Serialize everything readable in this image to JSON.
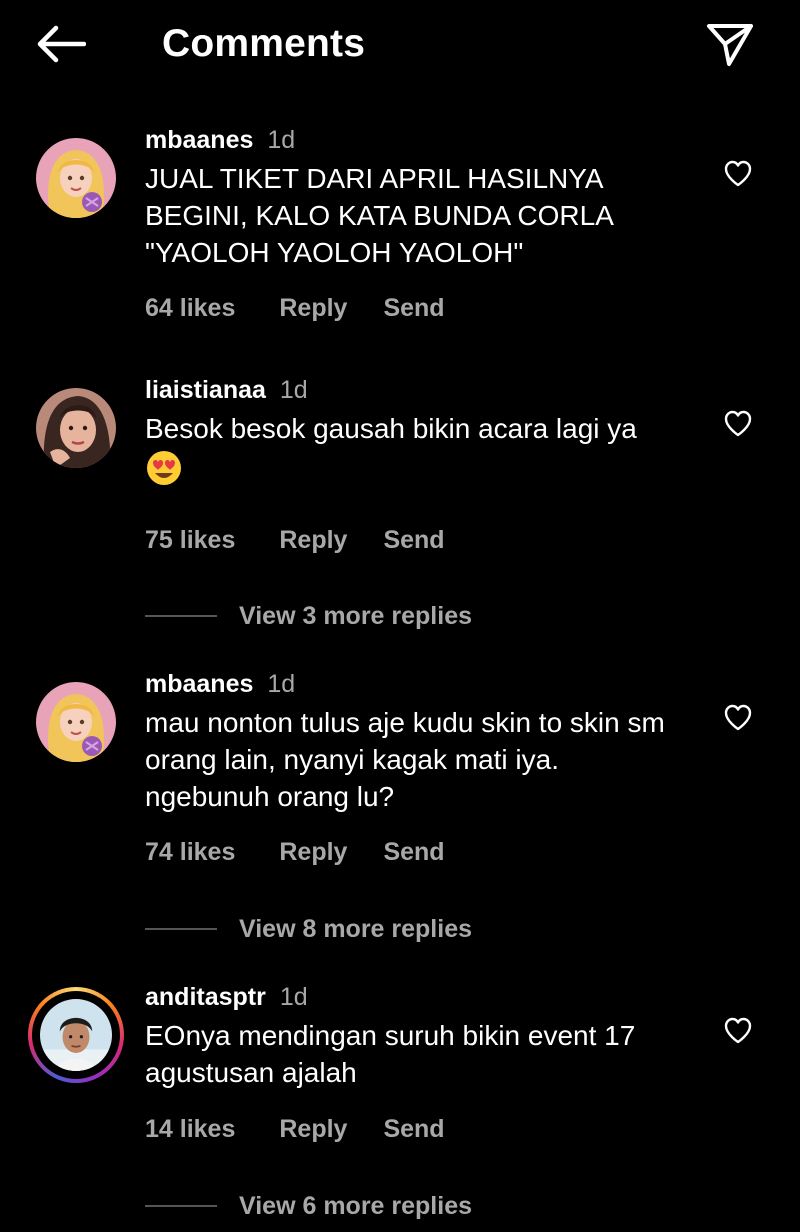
{
  "header": {
    "title": "Comments",
    "back_icon": "arrow-left-icon",
    "share_icon": "paper-plane-icon"
  },
  "comments": [
    {
      "username": "mbaanes",
      "time": "1d",
      "text": "JUAL TIKET DARI APRIL HASILNYA BEGINI, KALO KATA BUNDA CORLA \"YAOLOH YAOLOH YAOLOH\"",
      "likes": "64 likes",
      "reply": "Reply",
      "send": "Send"
    },
    {
      "username": "liaistianaa",
      "time": "1d",
      "text": "Besok besok gausah bikin acara lagi ya",
      "emoji": "heart-eyes-emoji",
      "likes": "75 likes",
      "reply": "Reply",
      "send": "Send",
      "view_replies": "View 3 more replies"
    },
    {
      "username": "mbaanes",
      "time": "1d",
      "text": "mau nonton tulus aje kudu skin to skin sm orang lain, nyanyi kagak mati iya. ngebunuh orang lu?",
      "likes": "74 likes",
      "reply": "Reply",
      "send": "Send",
      "view_replies": "View 8 more replies"
    },
    {
      "username": "anditasptr",
      "time": "1d",
      "text": "EOnya mendingan suruh bikin event 17 agustusan ajalah",
      "likes": "14 likes",
      "reply": "Reply",
      "send": "Send",
      "view_replies": "View 6 more replies"
    }
  ],
  "colors": {
    "background": "#000000",
    "text_primary": "#ffffff",
    "text_secondary": "#a8a8a8"
  }
}
